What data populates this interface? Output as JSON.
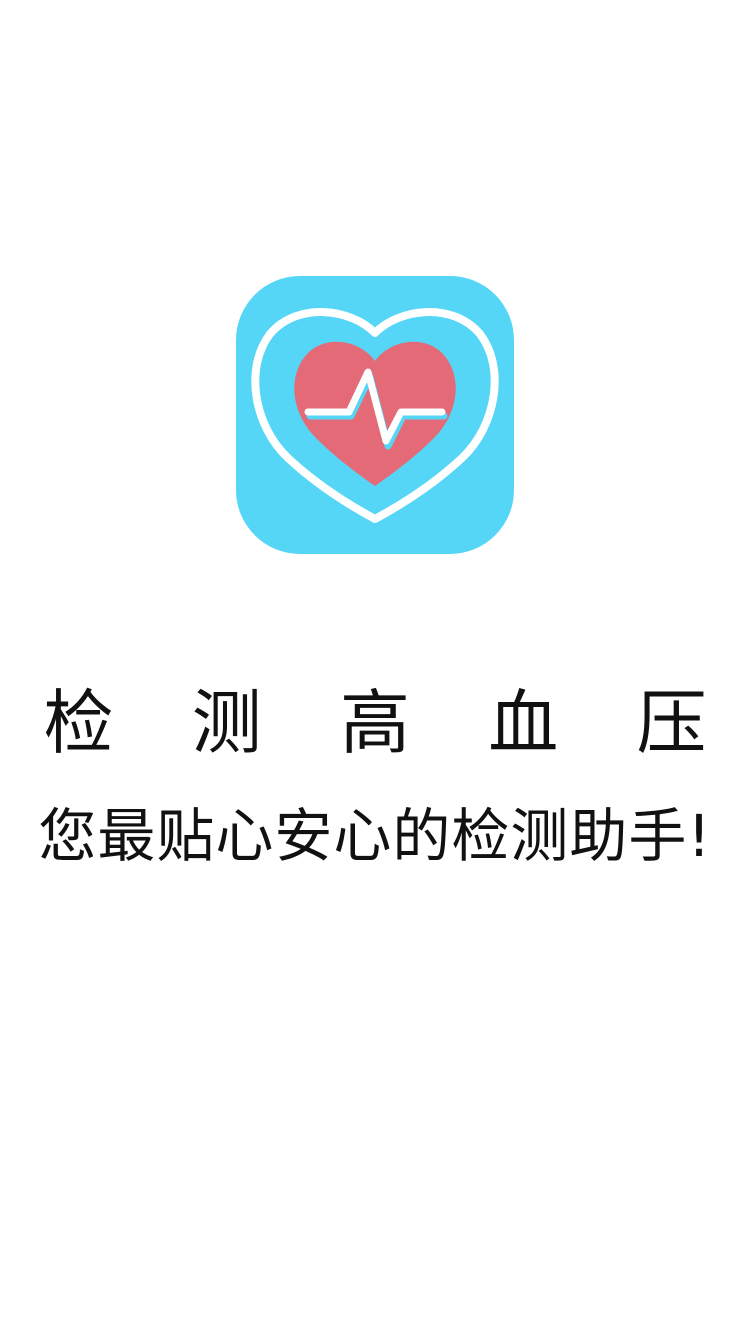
{
  "app": {
    "icon_name": "heart-pulse-icon",
    "title": "检 测 高 血 压",
    "tagline": "您最贴心安心的检测助手!"
  },
  "colors": {
    "background": "#ffffff",
    "icon_background": "#56d6f6",
    "heart_fill": "#e46a78",
    "heart_outline": "#ffffff",
    "text": "#111111"
  }
}
